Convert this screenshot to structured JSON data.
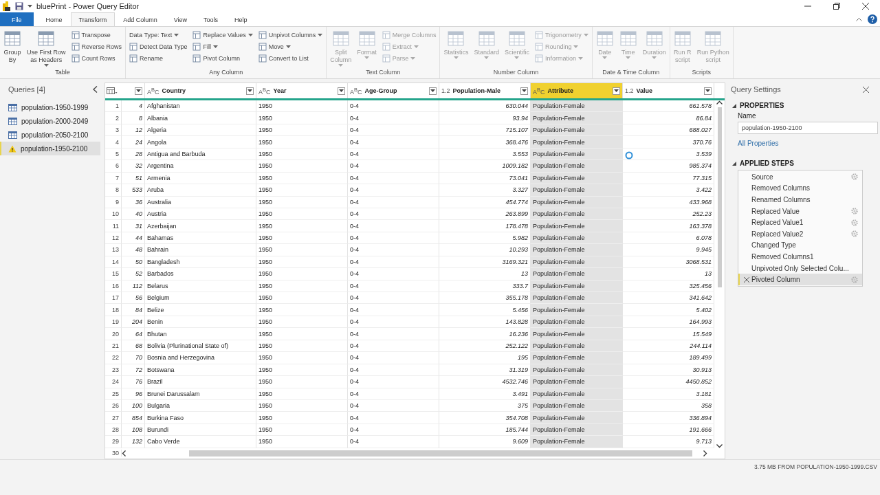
{
  "window": {
    "title": "bluePrint - Power Query Editor"
  },
  "tabs": [
    {
      "label": "File",
      "kind": "file",
      "selected": false
    },
    {
      "label": "Home",
      "kind": "tab",
      "selected": false
    },
    {
      "label": "Transform",
      "kind": "tab",
      "selected": true
    },
    {
      "label": "Add Column",
      "kind": "tab",
      "selected": false
    },
    {
      "label": "View",
      "kind": "tab",
      "selected": false
    },
    {
      "label": "Tools",
      "kind": "tab",
      "selected": false
    },
    {
      "label": "Help",
      "kind": "tab",
      "selected": false
    }
  ],
  "ribbon": [
    {
      "label": "Table",
      "disabled": false,
      "columns": [
        {
          "kind": "large",
          "lines": [
            "Group",
            "By"
          ],
          "dropdown": false
        },
        {
          "kind": "large",
          "lines": [
            "Use First Row",
            "as Headers"
          ],
          "dropdown": true
        },
        {
          "kind": "stack",
          "items": [
            {
              "kind": "command",
              "label": "Transpose",
              "dropdown": false
            },
            {
              "kind": "command",
              "label": "Reverse Rows",
              "dropdown": false
            },
            {
              "kind": "command",
              "label": "Count Rows",
              "dropdown": false
            }
          ]
        }
      ]
    },
    {
      "label": "Any Column",
      "disabled": false,
      "columns": [
        {
          "kind": "stack",
          "items": [
            {
              "kind": "plain",
              "label": "Data Type: Text",
              "dropdown": true
            },
            {
              "kind": "command",
              "label": "Detect Data Type",
              "dropdown": false
            },
            {
              "kind": "command",
              "label": "Rename",
              "dropdown": false
            }
          ]
        },
        {
          "kind": "stack",
          "items": [
            {
              "kind": "command",
              "label": "Replace Values",
              "dropdown": true
            },
            {
              "kind": "command",
              "label": "Fill",
              "dropdown": true
            },
            {
              "kind": "command",
              "label": "Pivot Column",
              "dropdown": false
            }
          ]
        },
        {
          "kind": "stack",
          "items": [
            {
              "kind": "command",
              "label": "Unpivot Columns",
              "dropdown": true
            },
            {
              "kind": "command",
              "label": "Move",
              "dropdown": true
            },
            {
              "kind": "command",
              "label": "Convert to List",
              "dropdown": false
            }
          ]
        }
      ]
    },
    {
      "label": "Text Column",
      "disabled": true,
      "columns": [
        {
          "kind": "large",
          "lines": [
            "Split",
            "Column"
          ],
          "dropdown": true
        },
        {
          "kind": "large",
          "lines": [
            "Format"
          ],
          "dropdown": true
        },
        {
          "kind": "stack",
          "items": [
            {
              "kind": "command",
              "label": "Merge Columns",
              "dropdown": false
            },
            {
              "kind": "command",
              "label": "Extract",
              "dropdown": true
            },
            {
              "kind": "command",
              "label": "Parse",
              "dropdown": true
            }
          ]
        }
      ]
    },
    {
      "label": "Number Column",
      "disabled": true,
      "columns": [
        {
          "kind": "large",
          "lines": [
            "Statistics"
          ],
          "dropdown": true
        },
        {
          "kind": "large",
          "lines": [
            "Standard"
          ],
          "dropdown": true
        },
        {
          "kind": "large",
          "lines": [
            "Scientific"
          ],
          "dropdown": true
        },
        {
          "kind": "stack",
          "items": [
            {
              "kind": "command",
              "label": "Trigonometry",
              "dropdown": true
            },
            {
              "kind": "command",
              "label": "Rounding",
              "dropdown": true
            },
            {
              "kind": "command",
              "label": "Information",
              "dropdown": true
            }
          ]
        }
      ]
    },
    {
      "label": "Date & Time Column",
      "disabled": true,
      "columns": [
        {
          "kind": "large",
          "lines": [
            "Date"
          ],
          "dropdown": true
        },
        {
          "kind": "large",
          "lines": [
            "Time"
          ],
          "dropdown": true
        },
        {
          "kind": "large",
          "lines": [
            "Duration"
          ],
          "dropdown": true
        }
      ]
    },
    {
      "label": "Scripts",
      "disabled": true,
      "columns": [
        {
          "kind": "large",
          "lines": [
            "Run R",
            "script"
          ],
          "dropdown": false
        },
        {
          "kind": "large",
          "lines": [
            "Run Python",
            "script"
          ],
          "dropdown": false
        }
      ]
    }
  ],
  "queries": {
    "title": "Queries [4]",
    "items": [
      {
        "name": "population-1950-1999",
        "kind": "table",
        "selected": false
      },
      {
        "name": "population-2000-2049",
        "kind": "table",
        "selected": false
      },
      {
        "name": "population-2050-2100",
        "kind": "table",
        "selected": false
      },
      {
        "name": "population-1950-2100",
        "kind": "warning",
        "selected": true
      }
    ]
  },
  "table": {
    "columns": [
      {
        "numeric": true,
        "selected": false
      },
      {
        "type_label": "A$^{B}$C",
        "name": "Country",
        "numeric": false,
        "selected": false
      },
      {
        "type_label": "A$^{B}$C",
        "name": "Year",
        "numeric": false,
        "selected": false
      },
      {
        "type_label": "A$^{B}$C",
        "name": "Age-Group",
        "numeric": false,
        "selected": false
      },
      {
        "type_label": "1.2",
        "name": "Population-Male",
        "numeric": true,
        "selected": false
      },
      {
        "type_label": "A$^{B}$C",
        "name": "Attribute",
        "numeric": false,
        "selected": true
      },
      {
        "type_label": "1.2",
        "name": "Value",
        "numeric": true,
        "selected": false
      }
    ],
    "rows": [
      {
        "num": "1",
        "cells": [
          "4",
          "Afghanistan",
          "1950",
          "0-4",
          "630.044",
          "Population-Female",
          "661.578"
        ]
      },
      {
        "num": "2",
        "cells": [
          "8",
          "Albania",
          "1950",
          "0-4",
          "93.94",
          "Population-Female",
          "86.84"
        ]
      },
      {
        "num": "3",
        "cells": [
          "12",
          "Algeria",
          "1950",
          "0-4",
          "715.107",
          "Population-Female",
          "688.027"
        ]
      },
      {
        "num": "4",
        "cells": [
          "24",
          "Angola",
          "1950",
          "0-4",
          "368.476",
          "Population-Female",
          "370.76"
        ]
      },
      {
        "num": "5",
        "cells": [
          "28",
          "Antigua and Barbuda",
          "1950",
          "0-4",
          "3.553",
          "Population-Female",
          "3.539"
        ]
      },
      {
        "num": "6",
        "cells": [
          "32",
          "Argentina",
          "1950",
          "0-4",
          "1009.182",
          "Population-Female",
          "985.374"
        ]
      },
      {
        "num": "7",
        "cells": [
          "51",
          "Armenia",
          "1950",
          "0-4",
          "73.041",
          "Population-Female",
          "77.315"
        ]
      },
      {
        "num": "8",
        "cells": [
          "533",
          "Aruba",
          "1950",
          "0-4",
          "3.327",
          "Population-Female",
          "3.422"
        ]
      },
      {
        "num": "9",
        "cells": [
          "36",
          "Australia",
          "1950",
          "0-4",
          "454.774",
          "Population-Female",
          "433.968"
        ]
      },
      {
        "num": "10",
        "cells": [
          "40",
          "Austria",
          "1950",
          "0-4",
          "263.899",
          "Population-Female",
          "252.23"
        ]
      },
      {
        "num": "11",
        "cells": [
          "31",
          "Azerbaijan",
          "1950",
          "0-4",
          "178.478",
          "Population-Female",
          "163.378"
        ]
      },
      {
        "num": "12",
        "cells": [
          "44",
          "Bahamas",
          "1950",
          "0-4",
          "5.982",
          "Population-Female",
          "6.078"
        ]
      },
      {
        "num": "13",
        "cells": [
          "48",
          "Bahrain",
          "1950",
          "0-4",
          "10.293",
          "Population-Female",
          "9.945"
        ]
      },
      {
        "num": "14",
        "cells": [
          "50",
          "Bangladesh",
          "1950",
          "0-4",
          "3169.321",
          "Population-Female",
          "3068.531"
        ]
      },
      {
        "num": "15",
        "cells": [
          "52",
          "Barbados",
          "1950",
          "0-4",
          "13",
          "Population-Female",
          "13"
        ]
      },
      {
        "num": "16",
        "cells": [
          "112",
          "Belarus",
          "1950",
          "0-4",
          "333.7",
          "Population-Female",
          "325.456"
        ]
      },
      {
        "num": "17",
        "cells": [
          "56",
          "Belgium",
          "1950",
          "0-4",
          "355.178",
          "Population-Female",
          "341.642"
        ]
      },
      {
        "num": "18",
        "cells": [
          "84",
          "Belize",
          "1950",
          "0-4",
          "5.456",
          "Population-Female",
          "5.402"
        ]
      },
      {
        "num": "19",
        "cells": [
          "204",
          "Benin",
          "1950",
          "0-4",
          "143.828",
          "Population-Female",
          "164.993"
        ]
      },
      {
        "num": "20",
        "cells": [
          "64",
          "Bhutan",
          "1950",
          "0-4",
          "16.236",
          "Population-Female",
          "15.549"
        ]
      },
      {
        "num": "21",
        "cells": [
          "68",
          "Bolivia (Plurinational State of)",
          "1950",
          "0-4",
          "252.122",
          "Population-Female",
          "244.114"
        ]
      },
      {
        "num": "22",
        "cells": [
          "70",
          "Bosnia and Herzegovina",
          "1950",
          "0-4",
          "195",
          "Population-Female",
          "189.499"
        ]
      },
      {
        "num": "23",
        "cells": [
          "72",
          "Botswana",
          "1950",
          "0-4",
          "31.319",
          "Population-Female",
          "30.913"
        ]
      },
      {
        "num": "24",
        "cells": [
          "76",
          "Brazil",
          "1950",
          "0-4",
          "4532.746",
          "Population-Female",
          "4450.852"
        ]
      },
      {
        "num": "25",
        "cells": [
          "96",
          "Brunei Darussalam",
          "1950",
          "0-4",
          "3.491",
          "Population-Female",
          "3.181"
        ]
      },
      {
        "num": "26",
        "cells": [
          "100",
          "Bulgaria",
          "1950",
          "0-4",
          "375",
          "Population-Female",
          "358"
        ]
      },
      {
        "num": "27",
        "cells": [
          "854",
          "Burkina Faso",
          "1950",
          "0-4",
          "354.708",
          "Population-Female",
          "336.894"
        ]
      },
      {
        "num": "28",
        "cells": [
          "108",
          "Burundi",
          "1950",
          "0-4",
          "185.744",
          "Population-Female",
          "191.666"
        ]
      },
      {
        "num": "29",
        "cells": [
          "132",
          "Cabo Verde",
          "1950",
          "0-4",
          "9.609",
          "Population-Female",
          "9.713"
        ]
      }
    ],
    "partial_row_number": "30"
  },
  "settings": {
    "title": "Query Settings",
    "properties_heading": "PROPERTIES",
    "name_label": "Name",
    "name_value": "population-1950-2100",
    "all_properties": "All Properties",
    "steps_heading": "APPLIED STEPS",
    "steps": [
      {
        "label": "Source",
        "has_settings": true,
        "selected": false
      },
      {
        "label": "Removed Columns",
        "has_settings": false,
        "selected": false
      },
      {
        "label": "Renamed Columns",
        "has_settings": false,
        "selected": false
      },
      {
        "label": "Replaced Value",
        "has_settings": true,
        "selected": false
      },
      {
        "label": "Replaced Value1",
        "has_settings": true,
        "selected": false
      },
      {
        "label": "Replaced Value2",
        "has_settings": true,
        "selected": false
      },
      {
        "label": "Changed Type",
        "has_settings": false,
        "selected": false
      },
      {
        "label": "Removed Columns1",
        "has_settings": false,
        "selected": false
      },
      {
        "label": "Unpivoted Only Selected Colu...",
        "has_settings": false,
        "selected": false
      },
      {
        "label": "Pivoted Column",
        "has_settings": true,
        "selected": true
      }
    ]
  },
  "status_bar": {
    "text": "3.75 MB FROM POPULATION-1950-1999.CSV"
  }
}
